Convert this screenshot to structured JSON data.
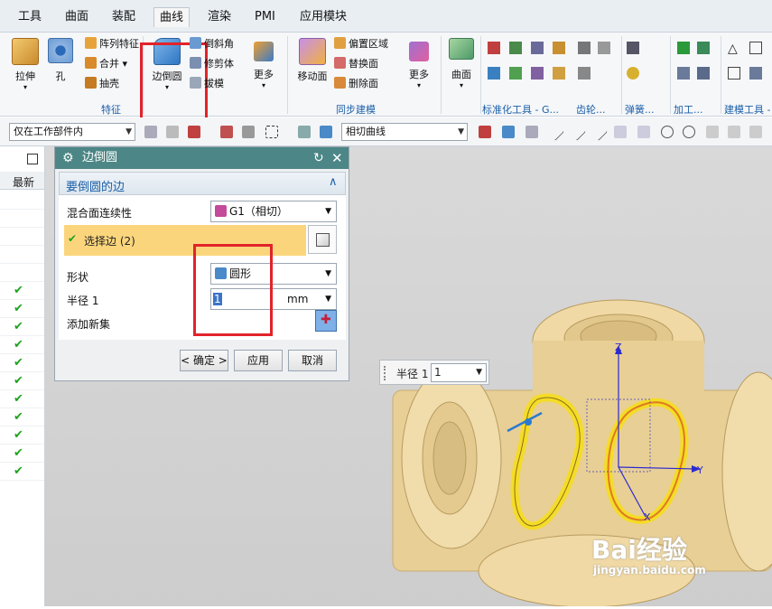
{
  "menubar": {
    "items": [
      "工具",
      "曲面",
      "装配",
      "曲线",
      "渲染",
      "PMI",
      "应用模块"
    ],
    "active_index": 3
  },
  "ribbon": {
    "feature_group": {
      "extrude": "拉伸",
      "hole": "孔",
      "pattern": "阵列特征",
      "unite": "合并",
      "shell": "抽壳",
      "label": "特征"
    },
    "edge_blend": "边倒圆",
    "chamfer": "倒斜角",
    "trim_body": "修剪体",
    "draft": "拔模",
    "more1": "更多",
    "sync_group": {
      "move_face": "移动面",
      "offset_region": "偏置区域",
      "replace_face": "替换面",
      "delete_face": "删除面",
      "label": "同步建模"
    },
    "more2": "更多",
    "surface": "曲面",
    "std_tools_label": "标准化工具 - G...",
    "gear_label": "齿轮...",
    "spring_label": "弹簧...",
    "machining_label": "加工...",
    "modeling_tools_label": "建模工具 -"
  },
  "toolbar2": {
    "scope_value": "仅在工作部件内",
    "curve_rule_value": "相切曲线"
  },
  "nav": {
    "header_col": "最新",
    "check_rows": 11
  },
  "dialog": {
    "title": "边倒圆",
    "section_title": "要倒圆的边",
    "continuity_label": "混合面连续性",
    "continuity_value": "G1（相切）",
    "select_edge_label": "选择边 (2)",
    "shape_label": "形状",
    "shape_value": "圆形",
    "radius_label": "半径 1",
    "radius_value": "1",
    "radius_unit": "mm",
    "add_set_label": "添加新集",
    "ok_button": "< 确定 >",
    "apply_button": "应用",
    "cancel_button": "取消"
  },
  "float_radius": {
    "label": "半径 1",
    "value": "1"
  },
  "axes": {
    "z": "Z",
    "y": "Y",
    "x": "X"
  },
  "watermark": {
    "logo": "Bai经验",
    "url": "jingyan.baidu.com"
  },
  "colors": {
    "highlight_box": "#e2232a",
    "dialog_title_bg": "#4c8686",
    "section_highlight": "#fbd57c",
    "check_green": "#1fa31f",
    "part_tan": "#e8cf96",
    "blend_yellow": "#f4dc28"
  }
}
